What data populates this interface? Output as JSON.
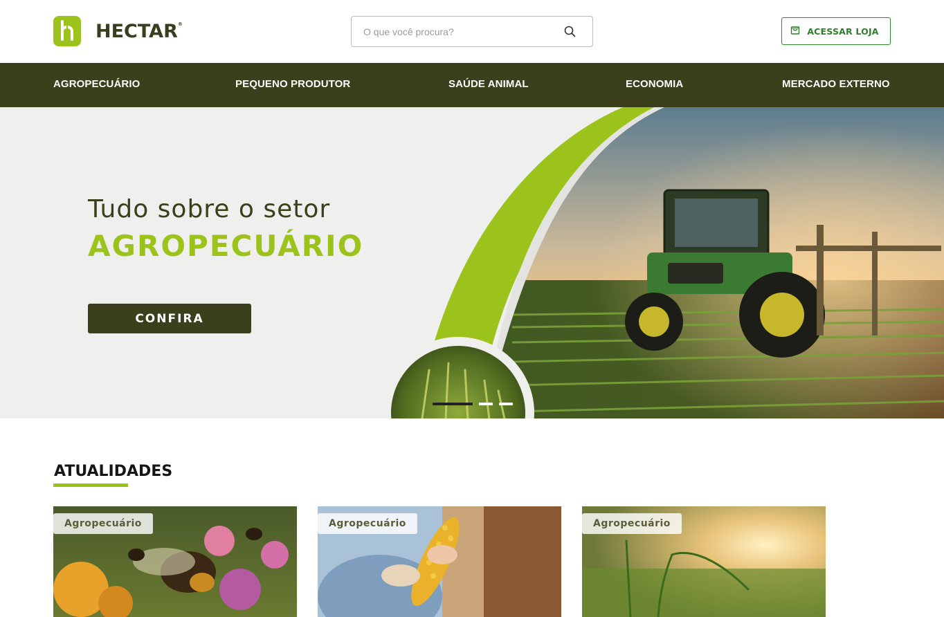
{
  "header": {
    "logo_text": "HECTAR",
    "logo_reg": "®",
    "search_placeholder": "O que você procura?",
    "store_button": "ACESSAR LOJA"
  },
  "nav": {
    "items": [
      {
        "label": "AGROPECUÁRIO"
      },
      {
        "label": "PEQUENO PRODUTOR"
      },
      {
        "label": "SAÚDE ANIMAL"
      },
      {
        "label": "ECONOMIA"
      },
      {
        "label": "MERCADO EXTERNO"
      }
    ]
  },
  "hero": {
    "title": "Tudo sobre o setor",
    "subtitle": "AGROPECUÁRIO",
    "cta": "CONFIRA",
    "slides_total": 3,
    "active_slide": 1
  },
  "news": {
    "section_title": "ATUALIDADES",
    "cards": [
      {
        "tag": "Agropecuário",
        "image": "bees-on-flowers"
      },
      {
        "tag": "Agropecuário",
        "image": "corn-harvest"
      },
      {
        "tag": "Agropecuário",
        "image": "wheat-field-sunset"
      }
    ]
  },
  "colors": {
    "brand_green": "#9cc31b",
    "dark_olive": "#3b3f1b",
    "store_green": "#2e7d2b"
  }
}
